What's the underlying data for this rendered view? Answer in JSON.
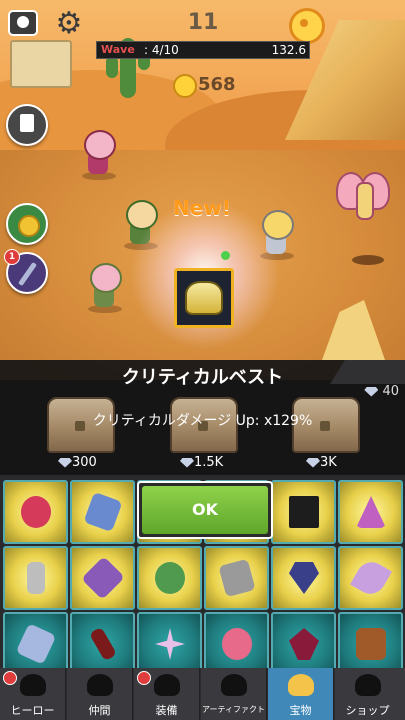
{
  "hud": {
    "stage": "11",
    "wave_label": "Wave",
    "wave_count": ": 4/10",
    "wave_timer": "132.6",
    "gold": "568"
  },
  "side_buttons": {
    "sword_badge": "1"
  },
  "popup": {
    "new_label": "New!",
    "item_name": "クリティカルベスト",
    "effect": "クリティカルダメージ Up: x129%",
    "ok": "OK",
    "icon": "vest-icon"
  },
  "chests": {
    "top_gems": "40",
    "prices": [
      "300",
      "1.5K",
      "3K"
    ]
  },
  "nav": {
    "tabs": [
      {
        "label": "ヒーロー",
        "icon": "hero-icon"
      },
      {
        "label": "仲間",
        "icon": "party-icon"
      },
      {
        "label": "装備",
        "icon": "equipment-icon"
      },
      {
        "label": "アーティファクト",
        "icon": "artifact-icon"
      },
      {
        "label": "宝物",
        "icon": "treasure-icon"
      },
      {
        "label": "ショップ",
        "icon": "shop-icon"
      }
    ]
  },
  "colors": {
    "accent_new": "#ff9a1a",
    "ok_green": "#6fbd33",
    "active_tab": "#3f88b8",
    "wave_red": "#e35050"
  }
}
